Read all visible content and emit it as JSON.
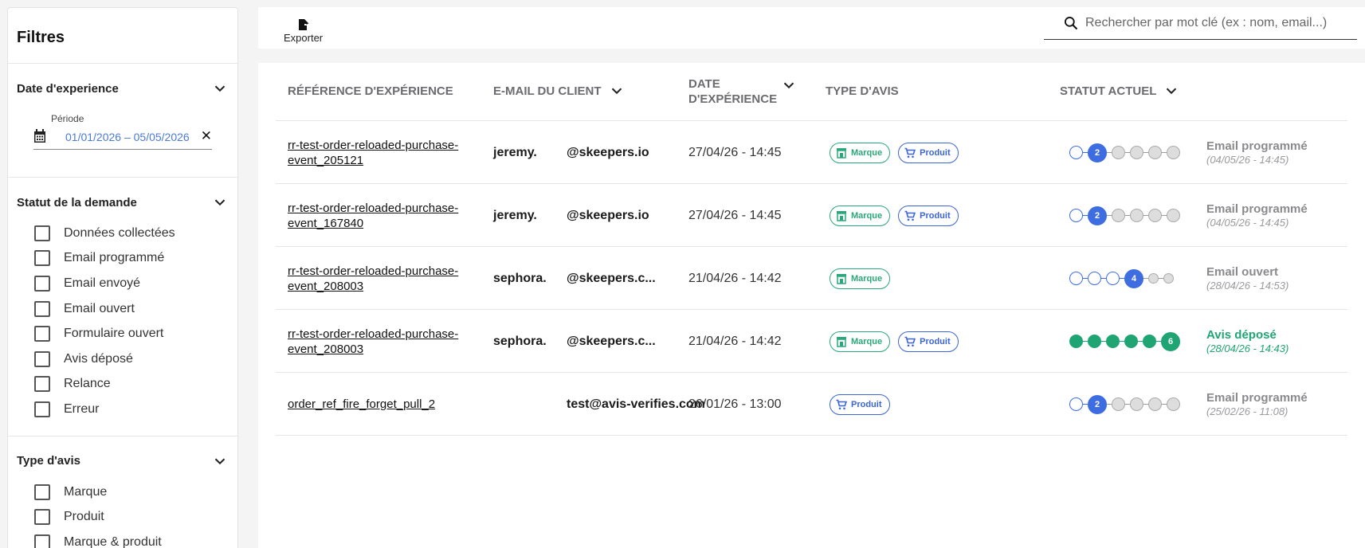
{
  "sidebar": {
    "title": "Filtres",
    "date_section": {
      "title": "Date d'experience",
      "period_label": "Période",
      "period_value": "01/01/2026 – 05/05/2026",
      "clear_glyph": "✕"
    },
    "status_section": {
      "title": "Statut de la demande",
      "options": [
        "Données collectées",
        "Email programmé",
        "Email envoyé",
        "Email ouvert",
        "Formulaire ouvert",
        "Avis déposé",
        "Relance",
        "Erreur"
      ]
    },
    "type_section": {
      "title": "Type d'avis",
      "options": [
        "Marque",
        "Produit",
        "Marque & produit"
      ]
    }
  },
  "toolbar": {
    "export_label": "Exporter",
    "search_placeholder": "Rechercher par mot clé (ex : nom, email...)"
  },
  "table": {
    "headers": {
      "ref": "RÉFÉRENCE D'EXPÉRIENCE",
      "email": "E-MAIL DU CLIENT",
      "date_line1": "DATE",
      "date_line2": "D'EXPÉRIENCE",
      "type": "TYPE D'AVIS",
      "status": "STATUT ACTUEL"
    },
    "badge_labels": {
      "marque": "Marque",
      "produit": "Produit"
    },
    "rows": [
      {
        "ref": "rr-test-order-reloaded-purchase-event_205121",
        "email_local": "jeremy.",
        "email_domain": "@skeepers.io",
        "date": "27/04/26 - 14:45",
        "types": [
          "marque",
          "produit"
        ],
        "step": 2,
        "status": "Email programmé",
        "status_date": "(04/05/26 - 14:45)",
        "state": "pending"
      },
      {
        "ref": "rr-test-order-reloaded-purchase-event_167840",
        "email_local": "jeremy.",
        "email_domain": "@skeepers.io",
        "date": "27/04/26 - 14:45",
        "types": [
          "marque",
          "produit"
        ],
        "step": 2,
        "status": "Email programmé",
        "status_date": "(04/05/26 - 14:45)",
        "state": "pending"
      },
      {
        "ref": "rr-test-order-reloaded-purchase-event_208003",
        "email_local": "sephora.",
        "email_domain": "@skeepers.c...",
        "date": "21/04/26 - 14:42",
        "types": [
          "marque"
        ],
        "step": 4,
        "status": "Email ouvert",
        "status_date": "(28/04/26 - 14:53)",
        "state": "pending"
      },
      {
        "ref": "rr-test-order-reloaded-purchase-event_208003",
        "email_local": "sephora.",
        "email_domain": "@skeepers.c...",
        "date": "21/04/26 - 14:42",
        "types": [
          "marque",
          "produit"
        ],
        "step": 6,
        "status": "Avis déposé",
        "status_date": "(28/04/26 - 14:43)",
        "state": "done"
      },
      {
        "ref": "order_ref_fire_forget_pull_2",
        "email_local": "",
        "email_domain": "test@avis-verifies.com",
        "date": "26/01/26 - 13:00",
        "types": [
          "produit"
        ],
        "step": 2,
        "status": "Email programmé",
        "status_date": "(25/02/26 - 11:08)",
        "state": "pending"
      }
    ]
  },
  "colors": {
    "blue": "#3d6de0",
    "green": "#1fa574",
    "marque": "#2aa87a",
    "produit": "#3a64d8"
  }
}
